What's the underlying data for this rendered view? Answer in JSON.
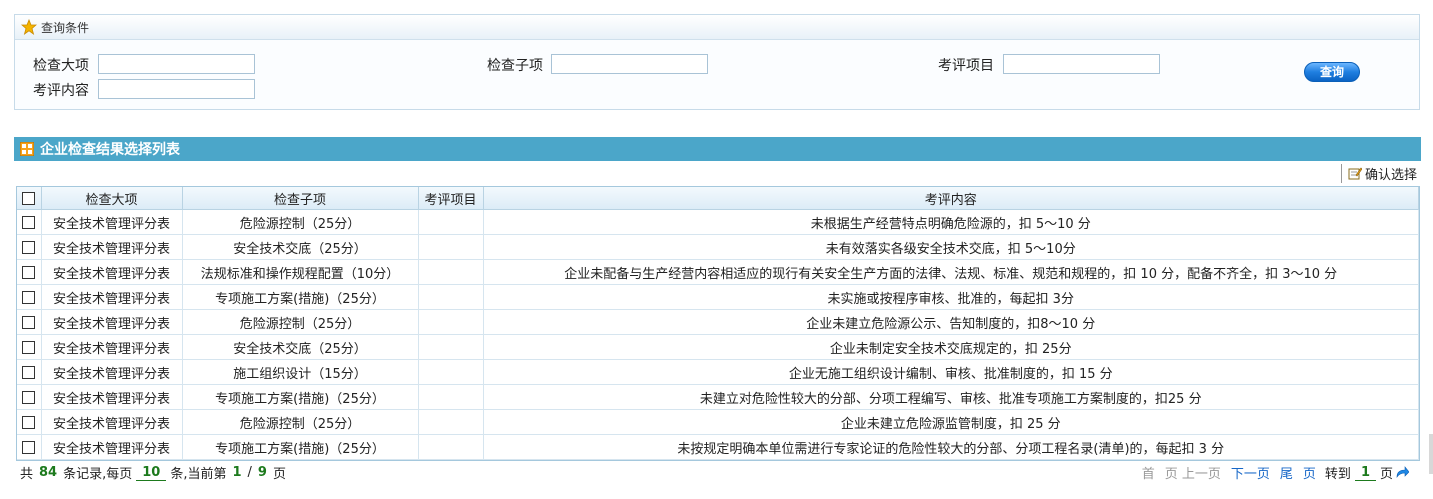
{
  "query": {
    "header": "查询条件",
    "labels": {
      "check_major": "检查大项",
      "check_sub": "检查子项",
      "eval_item": "考评项目",
      "eval_content": "考评内容"
    },
    "values": {
      "check_major": "",
      "check_sub": "",
      "eval_item": "",
      "eval_content": ""
    },
    "search_label": "查询"
  },
  "list": {
    "title": "企业检查结果选择列表",
    "confirm_label": "确认选择",
    "columns": [
      "检查大项",
      "检查子项",
      "考评项目",
      "考评内容"
    ],
    "rows": [
      {
        "major": "安全技术管理评分表",
        "sub": "危险源控制（25分）",
        "item": "",
        "content": "未根据生产经营特点明确危险源的，扣 5～10 分"
      },
      {
        "major": "安全技术管理评分表",
        "sub": "安全技术交底（25分）",
        "item": "",
        "content": "未有效落实各级安全技术交底，扣 5～10分"
      },
      {
        "major": "安全技术管理评分表",
        "sub": "法规标准和操作规程配置（10分）",
        "item": "",
        "content": "企业未配备与生产经营内容相适应的现行有关安全生产方面的法律、法规、标准、规范和规程的，扣 10 分，配备不齐全，扣 3～10 分"
      },
      {
        "major": "安全技术管理评分表",
        "sub": "专项施工方案(措施)（25分）",
        "item": "",
        "content": "未实施或按程序审核、批准的，每起扣 3分"
      },
      {
        "major": "安全技术管理评分表",
        "sub": "危险源控制（25分）",
        "item": "",
        "content": "企业未建立危险源公示、告知制度的，扣8～10 分"
      },
      {
        "major": "安全技术管理评分表",
        "sub": "安全技术交底（25分）",
        "item": "",
        "content": "企业未制定安全技术交底规定的，扣 25分"
      },
      {
        "major": "安全技术管理评分表",
        "sub": "施工组织设计（15分）",
        "item": "",
        "content": "企业无施工组织设计编制、审核、批准制度的，扣 15 分"
      },
      {
        "major": "安全技术管理评分表",
        "sub": "专项施工方案(措施)（25分）",
        "item": "",
        "content": "未建立对危险性较大的分部、分项工程编写、审核、批准专项施工方案制度的，扣25 分"
      },
      {
        "major": "安全技术管理评分表",
        "sub": "危险源控制（25分）",
        "item": "",
        "content": "企业未建立危险源监管制度，扣 25 分"
      },
      {
        "major": "安全技术管理评分表",
        "sub": "专项施工方案(措施)（25分）",
        "item": "",
        "content": "未按规定明确本单位需进行专家论证的危险性较大的分部、分项工程名录(清单)的，每起扣 3 分"
      }
    ]
  },
  "pager": {
    "total_prefix": "共",
    "total": "84",
    "per_page_prefix": "条记录,每页",
    "per_page": "10",
    "current_prefix": "条,当前第",
    "current": "1",
    "slash": "/",
    "pages": "9",
    "page_suffix": "页",
    "first": "首",
    "prev_page": "页 上一页",
    "next": "下一页",
    "last": "尾",
    "last_suffix": "页",
    "goto_label": "转到",
    "goto_value": "1",
    "goto_suffix": "页"
  },
  "colors": {
    "title_bar": "#4ba6c9",
    "accent_green": "#1d7a1d",
    "link_blue": "#1767c8"
  }
}
